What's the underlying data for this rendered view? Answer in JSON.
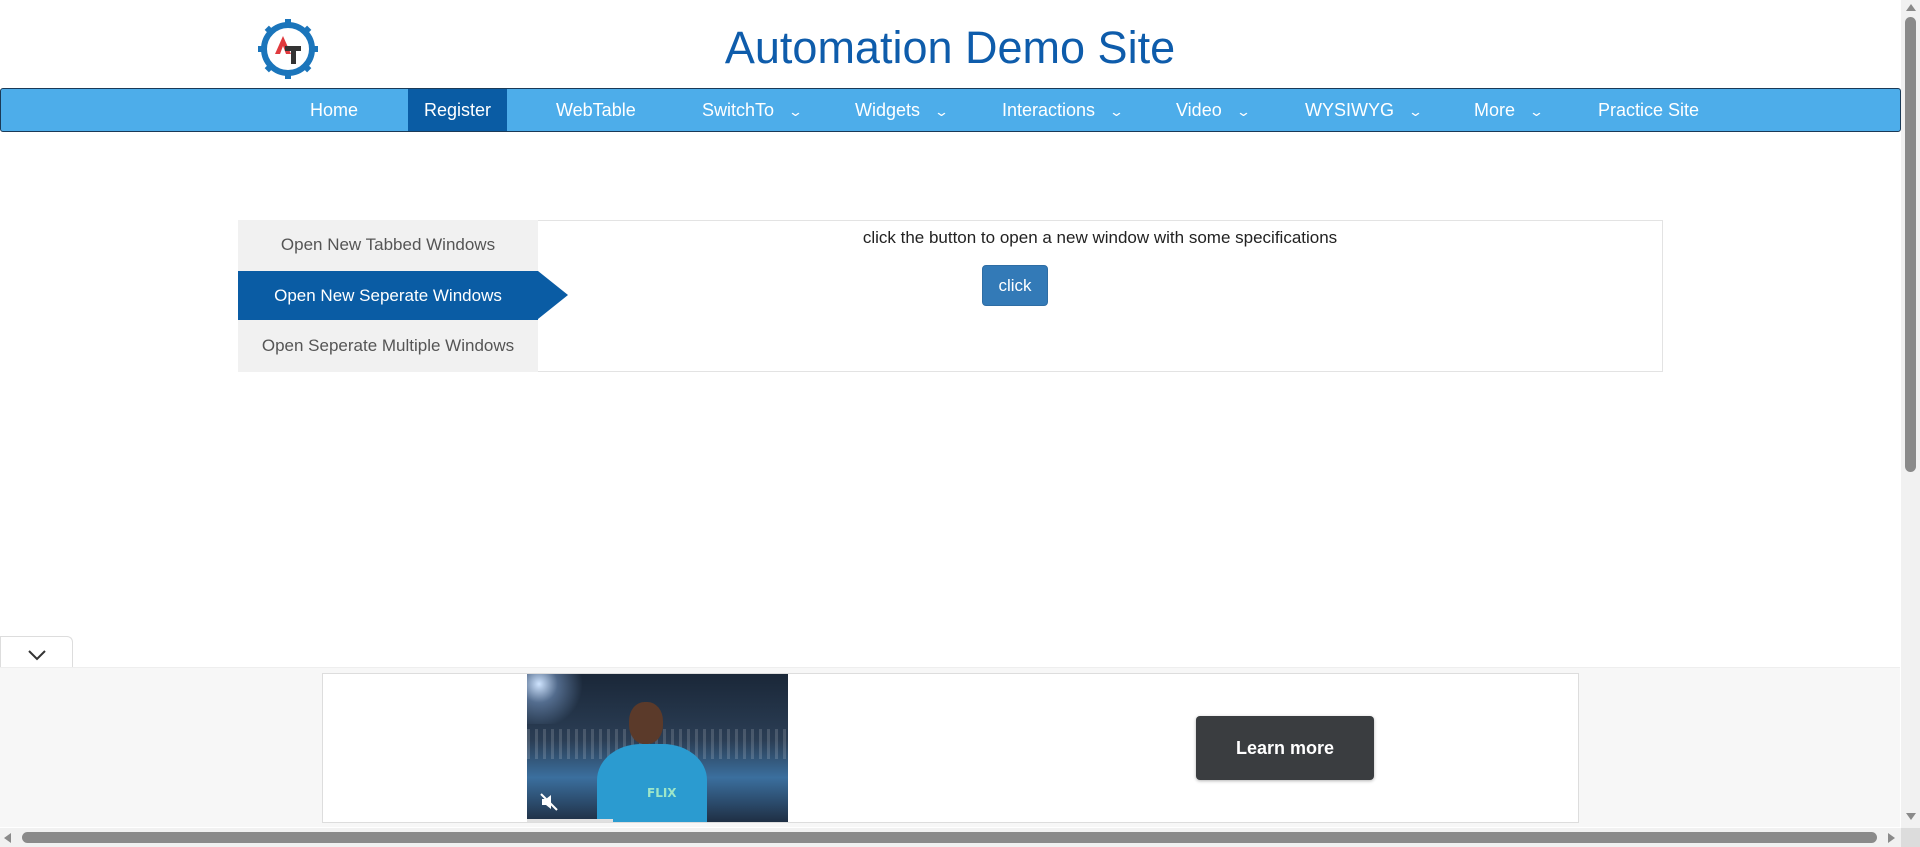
{
  "header": {
    "title": "Automation Demo Site",
    "logo_icon": "gear-logo-icon",
    "logo_letters": "AT",
    "colors": {
      "title": "#0e5cab",
      "logo_gear": "#1b75bb",
      "logo_a": "#e03a3e",
      "logo_t": "#333333"
    }
  },
  "nav": {
    "items": [
      {
        "label": "Home",
        "dropdown": false,
        "active": false
      },
      {
        "label": "Register",
        "dropdown": false,
        "active": true
      },
      {
        "label": "WebTable",
        "dropdown": false,
        "active": false
      },
      {
        "label": "SwitchTo",
        "dropdown": true,
        "active": false
      },
      {
        "label": "Widgets",
        "dropdown": true,
        "active": false
      },
      {
        "label": "Interactions",
        "dropdown": true,
        "active": false
      },
      {
        "label": "Video",
        "dropdown": true,
        "active": false
      },
      {
        "label": "WYSIWYG",
        "dropdown": true,
        "active": false
      },
      {
        "label": "More",
        "dropdown": true,
        "active": false
      },
      {
        "label": "Practice Site",
        "dropdown": false,
        "active": false
      }
    ],
    "colors": {
      "bar": "#4dadea",
      "active": "#0a5ca4"
    }
  },
  "windows_tabs": {
    "items": [
      {
        "label": "Open New Tabbed Windows",
        "active": false
      },
      {
        "label": "Open New Seperate Windows",
        "active": true
      },
      {
        "label": "Open Seperate Multiple Windows",
        "active": false
      }
    ],
    "panel_text": "click the button to open a new window with some specifications",
    "button_label": "click"
  },
  "ad": {
    "toggle_icon": "chevron-down-icon",
    "shirt_text": "FLIX",
    "mute_icon": "mute-icon",
    "cta_label": "Learn more",
    "video_progress": 0.33
  }
}
